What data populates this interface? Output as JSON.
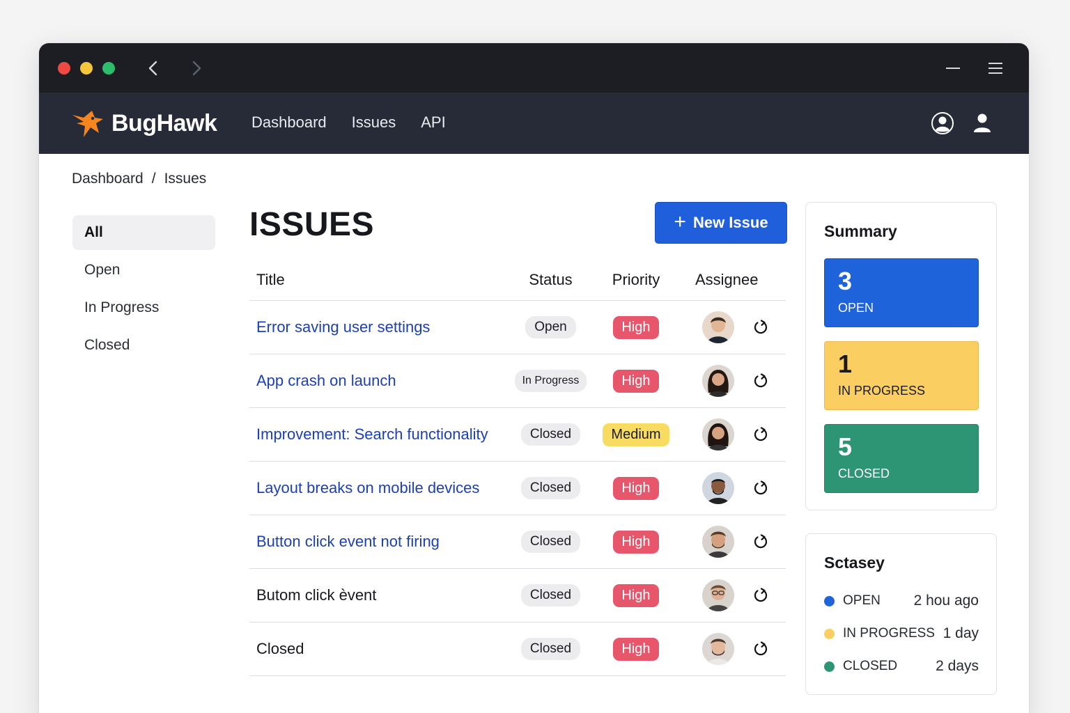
{
  "colors": {
    "brand": "#f5851f",
    "primary": "#1f5fdb",
    "open": "#1f63db",
    "in_progress": "#fbce62",
    "closed": "#2e9574",
    "high": "#e8566c",
    "medium": "#f8dc62"
  },
  "window": {
    "icons": [
      "back-icon",
      "forward-icon",
      "minimize-icon",
      "menu-icon"
    ]
  },
  "app": {
    "name": "BugHawk",
    "nav": [
      "Dashboard",
      "Issues",
      "API"
    ],
    "icons": [
      "account-circle-icon",
      "user-icon"
    ]
  },
  "breadcrumb": [
    "Dashboard",
    "/",
    "Issues"
  ],
  "sidebar": {
    "items": [
      "All",
      "Open",
      "In Progress",
      "Closed"
    ],
    "active": "All"
  },
  "main": {
    "title": "ISSUES",
    "new_button": "New Issue",
    "columns": [
      "Title",
      "Status",
      "Priority",
      "Assignee"
    ]
  },
  "issues": [
    {
      "title": "Error saving user settings",
      "status": "Open",
      "priority": "High"
    },
    {
      "title": "App crash on launch",
      "status": "In Progress",
      "priority": "High"
    },
    {
      "title": "Improvement: Search functionality",
      "status": "Closed",
      "priority": "Medium"
    },
    {
      "title": "Layout breaks on mobile devices",
      "status": "Closed",
      "priority": "High"
    },
    {
      "title": "Button click event not firing",
      "status": "Closed",
      "priority": "High"
    },
    {
      "title": "Butom click èvent",
      "status": "Closed",
      "priority": "High"
    },
    {
      "title": "Closed",
      "status": "Closed",
      "priority": "High"
    }
  ],
  "summary": {
    "title": "Summary",
    "stats": [
      {
        "count": "3",
        "label": "OPEN"
      },
      {
        "count": "1",
        "label": "IN PROGRESS"
      },
      {
        "count": "5",
        "label": "CLOSED"
      }
    ]
  },
  "activity": {
    "title": "Sctasey",
    "items": [
      {
        "label": "OPEN",
        "time": "2 hou ago"
      },
      {
        "label": "IN PROGRESS",
        "time": "1 day"
      },
      {
        "label": "CLOSED",
        "time": "2 days"
      }
    ]
  }
}
